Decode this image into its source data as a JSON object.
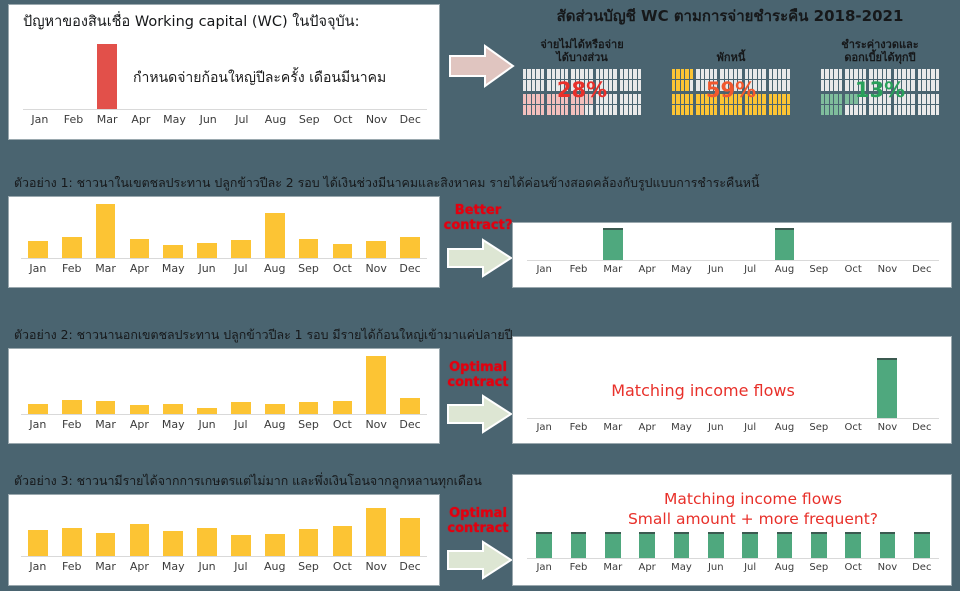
{
  "colors": {
    "background": "#4a6470",
    "yellow": "#fcc434",
    "red_bar": "#e2504a",
    "green": "#4fa87e",
    "red_text": "#e8302a",
    "arrow_pink": "#e0c5c0",
    "arrow_green": "#dde6d3",
    "pct_red": "#e8302a",
    "pct_orange": "#f0582e",
    "pct_green": "#29a05a"
  },
  "months": [
    "Jan",
    "Feb",
    "Mar",
    "Apr",
    "May",
    "Jun",
    "Jul",
    "Aug",
    "Sep",
    "Oct",
    "Nov",
    "Dec"
  ],
  "row1": {
    "title": "ปัญหาของสินเชื่อ Working capital (WC) ในปัจจุบัน:",
    "note": "กำหนดจ่ายก้อนใหญ่ปีละครั้ง เดือนมีนาคม",
    "arrow_name": "arrow-right-pink",
    "waffle_title": "สัดส่วนบัญชี WC ตามการจ่ายชำระคืน 2018-2021",
    "waffles": [
      {
        "label": "จ่ายไม่ได้หรือจ่าย\nได้บางส่วน",
        "percent": "28%",
        "value": 28,
        "color": "#f3c0bd",
        "text_color": "#e8302a"
      },
      {
        "label": "พักหนี้",
        "percent": "59%",
        "value": 59,
        "color": "#fcc434",
        "text_color": "#f0582e"
      },
      {
        "label": "ชำระค่างวดและ\nดอกเบี้ยได้ทุกปี",
        "percent": "13%",
        "value": 13,
        "color": "#7fbd9c",
        "text_color": "#29a05a"
      }
    ],
    "chart_data": {
      "type": "bar",
      "title": "",
      "categories": [
        "Jan",
        "Feb",
        "Mar",
        "Apr",
        "May",
        "Jun",
        "Jul",
        "Aug",
        "Sep",
        "Oct",
        "Nov",
        "Dec"
      ],
      "values": [
        0,
        0,
        100,
        0,
        0,
        0,
        0,
        0,
        0,
        0,
        0,
        0
      ],
      "ylim": [
        0,
        100
      ],
      "xlabel": "",
      "ylabel": "",
      "grid": false,
      "legend": "none",
      "series_color": "#e2504a"
    }
  },
  "row2": {
    "title": "ตัวอย่าง 1: ชาวนาในเขตชลประทาน ปลูกข้าวปีละ 2 รอบ ได้เงินช่วงมีนาคมและสิงหาคม รายได้ค่อนข้างสอดคล้องกับรูปแบบการชำระคืนหนี้",
    "arrow_caption": "Better\ncontract?",
    "arrow_caption_line1": "Better",
    "arrow_caption_line2": "contract?",
    "left_chart": {
      "type": "bar",
      "title": "",
      "categories": [
        "Jan",
        "Feb",
        "Mar",
        "Apr",
        "May",
        "Jun",
        "Jul",
        "Aug",
        "Sep",
        "Oct",
        "Nov",
        "Dec"
      ],
      "values": [
        32,
        38,
        100,
        35,
        24,
        27,
        34,
        84,
        36,
        26,
        31,
        39
      ],
      "ylim": [
        0,
        100
      ],
      "xlabel": "",
      "ylabel": "",
      "grid": false,
      "legend": "none",
      "series_color": "#fcc434"
    },
    "right_chart": {
      "type": "bar",
      "title": "",
      "categories": [
        "Jan",
        "Feb",
        "Mar",
        "Apr",
        "May",
        "Jun",
        "Jul",
        "Aug",
        "Sep",
        "Oct",
        "Nov",
        "Dec"
      ],
      "values": [
        0,
        0,
        100,
        0,
        0,
        0,
        0,
        100,
        0,
        0,
        0,
        0
      ],
      "ylim": [
        0,
        100
      ],
      "xlabel": "",
      "ylabel": "",
      "grid": false,
      "legend": "none",
      "series_color": "#4fa87e"
    }
  },
  "row3": {
    "title": "ตัวอย่าง 2: ชาวนานอกเขตชลประทาน ปลูกข้าวปีละ 1 รอบ มีรายได้ก้อนใหญ่เข้ามาแค่ปลายปี",
    "arrow_caption_line1": "Optimal",
    "arrow_caption_line2": "contract",
    "right_message": "Matching income flows",
    "left_chart": {
      "type": "bar",
      "title": "",
      "categories": [
        "Jan",
        "Feb",
        "Mar",
        "Apr",
        "May",
        "Jun",
        "Jul",
        "Aug",
        "Sep",
        "Oct",
        "Nov",
        "Dec"
      ],
      "values": [
        18,
        24,
        23,
        15,
        18,
        11,
        20,
        17,
        21,
        23,
        100,
        27
      ],
      "ylim": [
        0,
        100
      ],
      "xlabel": "",
      "ylabel": "",
      "grid": false,
      "legend": "none",
      "series_color": "#fcc434"
    },
    "right_chart": {
      "type": "bar",
      "title": "",
      "categories": [
        "Jan",
        "Feb",
        "Mar",
        "Apr",
        "May",
        "Jun",
        "Jul",
        "Aug",
        "Sep",
        "Oct",
        "Nov",
        "Dec"
      ],
      "values": [
        0,
        0,
        0,
        0,
        0,
        0,
        0,
        0,
        0,
        0,
        100,
        0
      ],
      "ylim": [
        0,
        100
      ],
      "xlabel": "",
      "ylabel": "",
      "grid": false,
      "legend": "none",
      "series_color": "#4fa87e"
    }
  },
  "row4": {
    "title": "ตัวอย่าง 3: ชาวนามีรายได้จากการเกษตรแต่ไม่มาก และพึ่งเงินโอนจากลูกหลานทุกเดือน",
    "arrow_caption_line1": "Optimal",
    "arrow_caption_line2": "contract",
    "right_message_line1": "Matching income flows",
    "right_message_line2": "Small amount + more frequent?",
    "left_chart": {
      "type": "bar",
      "title": "",
      "categories": [
        "Jan",
        "Feb",
        "Mar",
        "Apr",
        "May",
        "Jun",
        "Jul",
        "Aug",
        "Sep",
        "Oct",
        "Nov",
        "Dec"
      ],
      "values": [
        48,
        52,
        43,
        60,
        46,
        52,
        39,
        41,
        50,
        55,
        88,
        70
      ],
      "ylim": [
        0,
        100
      ],
      "xlabel": "",
      "ylabel": "",
      "grid": false,
      "legend": "none",
      "series_color": "#fcc434"
    },
    "right_chart": {
      "type": "bar",
      "title": "",
      "categories": [
        "Jan",
        "Feb",
        "Mar",
        "Apr",
        "May",
        "Jun",
        "Jul",
        "Aug",
        "Sep",
        "Oct",
        "Nov",
        "Dec"
      ],
      "values": [
        100,
        100,
        100,
        100,
        100,
        100,
        100,
        100,
        100,
        100,
        100,
        100
      ],
      "ylim": [
        0,
        100
      ],
      "xlabel": "",
      "ylabel": "",
      "grid": false,
      "legend": "none",
      "series_color": "#4fa87e"
    }
  }
}
